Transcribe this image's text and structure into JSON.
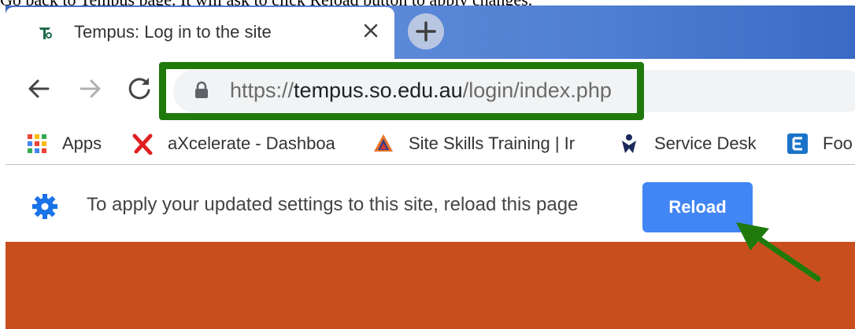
{
  "caption": "Go back to Tempus page. It will ask to click Reload button to apply changes.",
  "tab": {
    "title": "Tempus: Log in to the site",
    "favicon": "tempus-logo-icon",
    "close_icon": "close-icon"
  },
  "new_tab_icon": "plus-icon",
  "toolbar": {
    "back_icon": "arrow-left-icon",
    "forward_icon": "arrow-right-icon",
    "reload_icon": "refresh-icon",
    "lock_icon": "lock-icon",
    "url_scheme": "https://",
    "url_host": "tempus.so.edu.au",
    "url_path": "/login/index.php"
  },
  "bookmarks": [
    {
      "label": "Apps",
      "icon": "apps-grid-icon"
    },
    {
      "label": "aXcelerate - Dashboa",
      "icon": "axcelerate-x-icon"
    },
    {
      "label": "Site Skills Training | Ir",
      "icon": "site-skills-logo-icon"
    },
    {
      "label": "Service Desk",
      "icon": "service-desk-icon"
    },
    {
      "label": "Foo",
      "icon": "e-letter-icon"
    }
  ],
  "infobar": {
    "icon": "gear-icon",
    "message": "To apply your updated settings to this site, reload this page",
    "button_label": "Reload"
  },
  "colors": {
    "tabstrip": "#4f7fd2",
    "omnibox": "#f1f3f4",
    "highlight": "#1f7a0b",
    "button": "#4285f4",
    "banner": "#c84f1d",
    "annotation_arrow": "#1f7a0b"
  }
}
